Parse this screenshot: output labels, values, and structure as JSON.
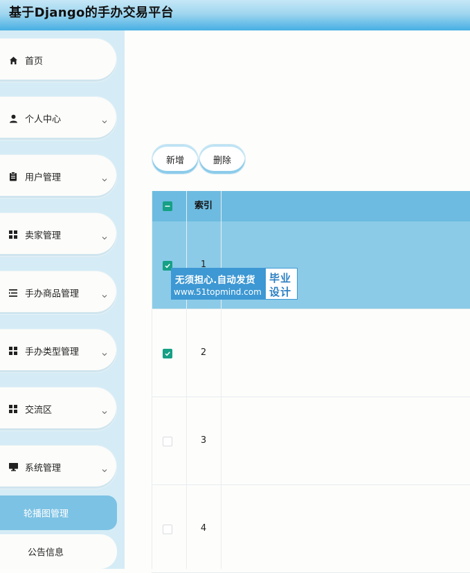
{
  "header": {
    "title": "基于Django的手办交易平台"
  },
  "sidebar": {
    "items": [
      {
        "label": "首页",
        "icon": "home-icon",
        "expandable": false
      },
      {
        "label": "个人中心",
        "icon": "user-icon",
        "expandable": true
      },
      {
        "label": "用户管理",
        "icon": "clipboard-icon",
        "expandable": true
      },
      {
        "label": "卖家管理",
        "icon": "grid-icon",
        "expandable": true
      },
      {
        "label": "手办商品管理",
        "icon": "list-icon",
        "expandable": true
      },
      {
        "label": "手办类型管理",
        "icon": "grid-icon",
        "expandable": true
      },
      {
        "label": "交流区",
        "icon": "grid-icon",
        "expandable": true
      },
      {
        "label": "系统管理",
        "icon": "monitor-icon",
        "expandable": true
      }
    ],
    "subitems": [
      {
        "label": "轮播图管理",
        "active": true
      },
      {
        "label": "公告信息",
        "active": false
      }
    ]
  },
  "toolbar": {
    "add_label": "新增",
    "delete_label": "删除"
  },
  "table": {
    "columns": [
      "索引"
    ],
    "rows": [
      {
        "index": "1",
        "checked": true,
        "selected": true
      },
      {
        "index": "2",
        "checked": true,
        "selected": false
      },
      {
        "index": "3",
        "checked": false,
        "selected": false
      },
      {
        "index": "4",
        "checked": false,
        "selected": false
      }
    ]
  },
  "watermark": {
    "line1": "无须担心.自动发货",
    "line2": "www.51topmind.com",
    "badge1": "毕业",
    "badge2": "设计"
  },
  "colors": {
    "header_accent": "#46afe3",
    "table_header": "#6dbbe0",
    "selected_row": "#8bcbe8",
    "checkbox_on": "#16a085",
    "sidebar_bg": "#d5ecf6"
  }
}
